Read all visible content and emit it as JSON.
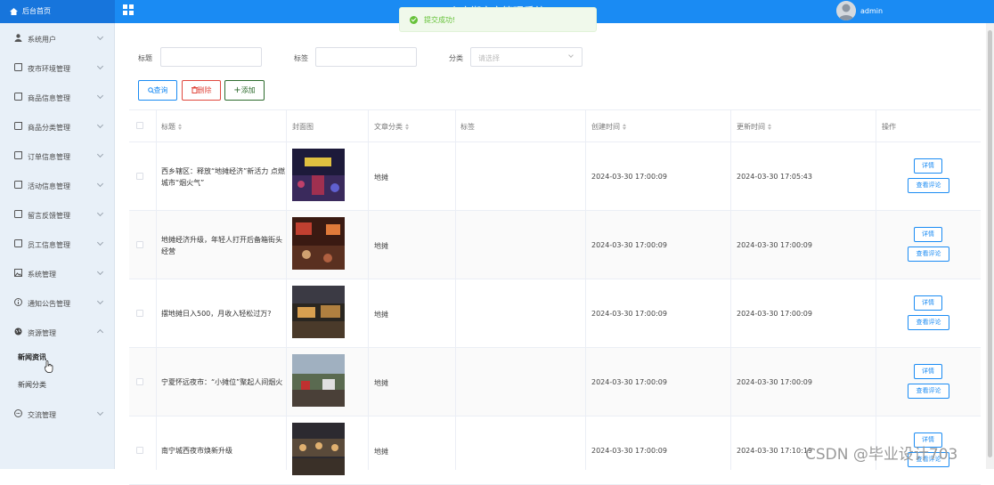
{
  "header": {
    "brand": "后台首页",
    "system_title": "小吃街夜市管理系统",
    "username": "admin"
  },
  "toast": {
    "message": "提交成功!"
  },
  "sidebar": {
    "items": [
      {
        "label": "系统用户",
        "icon": "user-icon"
      },
      {
        "label": "夜市环境管理",
        "icon": "page-icon"
      },
      {
        "label": "商品信息管理",
        "icon": "page-icon"
      },
      {
        "label": "商品分类管理",
        "icon": "page-icon"
      },
      {
        "label": "订单信息管理",
        "icon": "page-icon"
      },
      {
        "label": "活动信息管理",
        "icon": "page-icon"
      },
      {
        "label": "留言反馈管理",
        "icon": "page-icon"
      },
      {
        "label": "员工信息管理",
        "icon": "page-icon"
      },
      {
        "label": "系统管理",
        "icon": "image-icon"
      },
      {
        "label": "通知公告管理",
        "icon": "info-icon"
      },
      {
        "label": "资源管理",
        "icon": "globe-icon"
      },
      {
        "label": "交流管理",
        "icon": "chat-icon"
      }
    ],
    "sub_items": [
      {
        "label": "新闻资讯",
        "active": true
      },
      {
        "label": "新闻分类",
        "active": false
      }
    ]
  },
  "filters": {
    "title_label": "标题",
    "tag_label": "标签",
    "category_label": "分类",
    "category_placeholder": "请选择"
  },
  "actions": {
    "search": "查询",
    "delete": "删除",
    "add": "添加"
  },
  "table": {
    "headers": {
      "title": "标题",
      "cover": "封面图",
      "category": "文章分类",
      "tags": "标签",
      "created": "创建时间",
      "updated": "更新时间",
      "ops": "操作"
    },
    "detail_label": "详情",
    "comment_label": "查看评论",
    "rows": [
      {
        "title": "西乡辖区：释放“地摊经济”新活力 点燃城市“烟火气”",
        "category": "地摊",
        "created": "2024-03-30 17:00:09",
        "updated": "2024-03-30 17:05:43"
      },
      {
        "title": "地摊经济升级，年轻人打开后备箱街头经营",
        "category": "地摊",
        "created": "2024-03-30 17:00:09",
        "updated": "2024-03-30 17:00:09"
      },
      {
        "title": "摆地摊日入500，月收入轻松过万?",
        "category": "地摊",
        "created": "2024-03-30 17:00:09",
        "updated": "2024-03-30 17:00:09"
      },
      {
        "title": "宁夏怀远夜市：“小摊位”聚起人间烟火",
        "category": "地摊",
        "created": "2024-03-30 17:00:09",
        "updated": "2024-03-30 17:00:09"
      },
      {
        "title": "南宁城西夜市焕新升级",
        "category": "地摊",
        "created": "2024-03-30 17:00:09",
        "updated": "2024-03-30 17:10:19"
      }
    ]
  },
  "watermark": "CSDN @毕业设计703"
}
